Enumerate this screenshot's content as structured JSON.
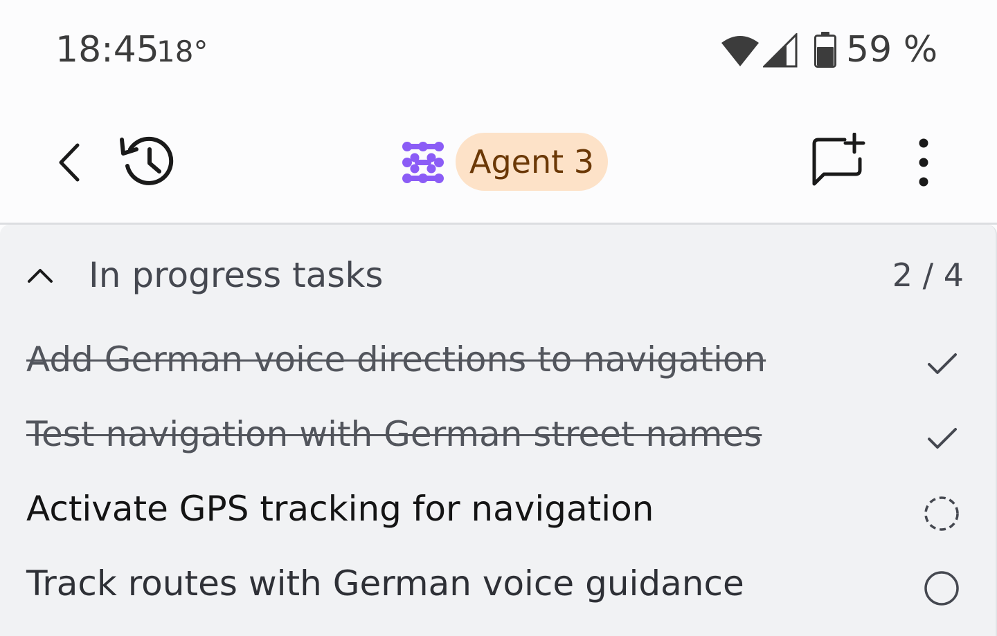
{
  "status_bar": {
    "time": "18:45",
    "temperature": "18°",
    "battery": "59 %"
  },
  "toolbar": {
    "agent_name": "Agent 3",
    "agent_chip_color": "#fde2c8",
    "agent_logo_color": "#8b5cf6"
  },
  "panel": {
    "title": "In progress tasks",
    "counter": "2 / 4",
    "tasks": [
      {
        "label": "Add German voice directions to navigation",
        "status": "done",
        "icon": "checkmark-icon"
      },
      {
        "label": "Test navigation with German street names",
        "status": "done",
        "icon": "checkmark-icon"
      },
      {
        "label": "Activate GPS tracking for navigation",
        "status": "in-progress",
        "icon": "dashed-circle-icon"
      },
      {
        "label": "Track routes with German voice guidance",
        "status": "pending",
        "icon": "empty-circle-icon"
      }
    ]
  }
}
